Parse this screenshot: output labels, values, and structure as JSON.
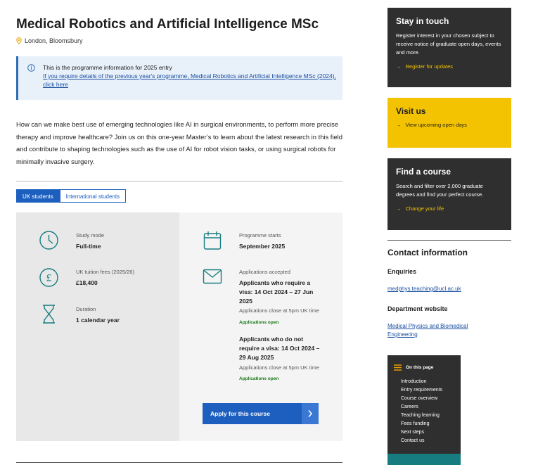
{
  "header": {
    "title": "Medical Robotics and Artificial Intelligence MSc",
    "location": "London, Bloomsbury"
  },
  "notice": {
    "line1": "This is the programme information for 2025 entry",
    "link": "If you require details of the previous year's programme, Medical Robotics and Artificial Intelligence MSc (2024), click here"
  },
  "intro": "How can we make best use of emerging technologies like AI in surgical environments, to perform more precise therapy and improve healthcare? Join us on this one-year Master’s to learn about the latest research in this field and contribute to shaping technologies such as the use of AI for robot vision tasks, or using surgical robots for minimally invasive surgery.",
  "tabs": [
    {
      "label": "UK students",
      "active": true
    },
    {
      "label": "International students",
      "active": false
    }
  ],
  "facts": {
    "study_mode": {
      "label": "Study mode",
      "value": "Full-time"
    },
    "fees": {
      "label": "UK tuition fees (2025/26)",
      "value": "£18,400"
    },
    "duration": {
      "label": "Duration",
      "value": "1 calendar year"
    },
    "starts": {
      "label": "Programme starts",
      "value": "September 2025"
    },
    "applications": {
      "label": "Applications accepted",
      "visa_line1": "Applicants who require a",
      "visa_line2": "visa: 14 Oct 2024 – 27 Jun",
      "visa_line3": "2025",
      "visa_note": "Applications close at 5pm UK time",
      "visa_status": "Applications open",
      "novisa_line1": "Applicants who do not",
      "novisa_line2": "require a visa: 14 Oct 2024 –",
      "novisa_line3": "29 Aug 2025",
      "novisa_note": "Applications close at 5pm UK time",
      "novisa_status": "Applications open"
    }
  },
  "apply_button": "Apply for this course",
  "sidebar": {
    "stay": {
      "title": "Stay in touch",
      "body": "Register interest in your chosen subject to receive notice of graduate open days, events and more.",
      "link": "Register for updates"
    },
    "visit": {
      "title": "Visit us",
      "link": "View upcoming open days"
    },
    "find": {
      "title": "Find a course",
      "body": "Search and filter over 2,000 graduate degrees and find your perfect course.",
      "link": "Change your life"
    },
    "contact": {
      "title": "Contact information",
      "enquiries_label": "Enquiries",
      "email": "medphys.teaching@ucl.ac.uk",
      "website_label": "Department website",
      "website_line1": "Medical Physics and Biomedical",
      "website_line2": "Engineering"
    },
    "on_this_page": {
      "title": "On this page",
      "items": [
        "Introduction",
        "Entry requirements",
        "Course overview",
        "Careers",
        "Teaching learning",
        "Fees funding",
        "Next steps",
        "Contact us"
      ]
    }
  },
  "colors": {
    "accent_blue": "#1d5fbf",
    "teal_icon": "#167c80",
    "yellow": "#f3c200",
    "dark": "#2f2f2f",
    "link_orange": "#f3c200",
    "open_green": "#1a7a1a"
  }
}
